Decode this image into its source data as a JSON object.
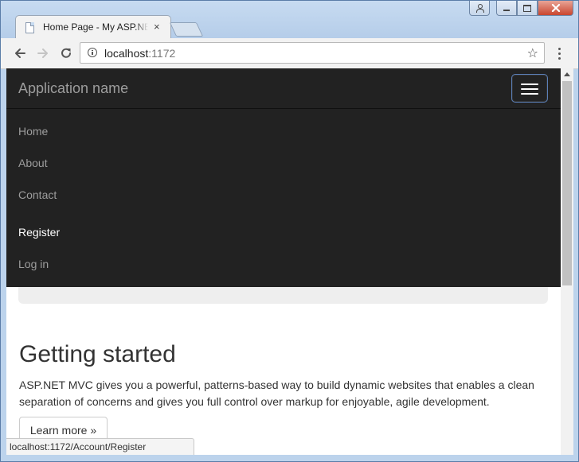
{
  "browser": {
    "tab": {
      "title": "Home Page - My ASP.NET Application",
      "close_glyph": "×"
    },
    "url": {
      "host": "localhost",
      "port": ":1172"
    },
    "bookmark_glyph": "☆",
    "back_glyph": "←",
    "forward_glyph": "→",
    "reload_glyph": "↻",
    "status_url": "localhost:1172/Account/Register"
  },
  "navbar": {
    "brand": "Application name",
    "links": [
      {
        "label": "Home"
      },
      {
        "label": "About"
      },
      {
        "label": "Contact"
      },
      {
        "label": "Register"
      },
      {
        "label": "Log in"
      }
    ]
  },
  "content": {
    "heading": "Getting started",
    "paragraph": "ASP.NET MVC gives you a powerful, patterns-based way to build dynamic websites that enables a clean separation of concerns and gives you full control over markup for enjoyable, agile development.",
    "button_label": "Learn more »"
  },
  "icons": {
    "tab_favicon": "page-icon",
    "info": "info-icon",
    "bookmark": "star-icon",
    "menu": "kebab-menu-icon",
    "toggle": "hamburger-icon"
  },
  "colors": {
    "navbar_bg": "#222222",
    "navbar_link": "#9d9d9d",
    "navbar_active_link": "#ffffff",
    "jumbotron_bg": "#eeeeee",
    "window_frame": "#bcd3ec",
    "close_button": "#c9452e"
  }
}
